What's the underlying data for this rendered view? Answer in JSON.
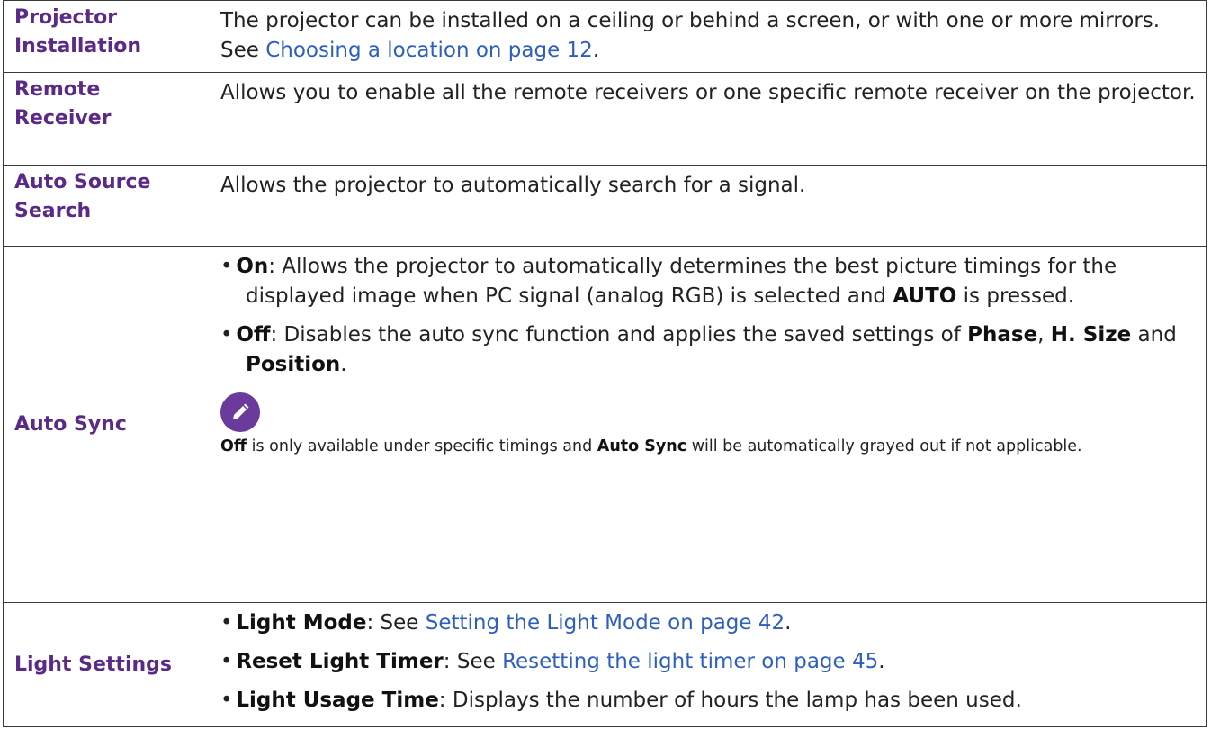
{
  "rows": [
    {
      "term": "Projector Installation",
      "desc_text": "The projector can be installed on a ceiling or behind a screen, or with one or more mirrors. See ",
      "desc_link": "Choosing a location on page 12",
      "desc_after": "."
    },
    {
      "term": "Remote Receiver",
      "desc_text": "Allows you to enable all the remote receivers or one specific remote receiver on the projector."
    },
    {
      "term": "Auto Source Search",
      "desc_text": "Allows the projector to automatically search for a signal."
    },
    {
      "term": "Auto Sync",
      "bullet_on_label": "On",
      "bullet_on_text": ": Allows the projector to automatically determines the best picture timings for the displayed image when PC signal (analog RGB) is selected and ",
      "bullet_on_key": "AUTO",
      "bullet_on_end": " is pressed.",
      "bullet_off_label": "Off",
      "bullet_off_text": ": Disables the auto sync function and applies the saved settings of ",
      "bullet_off_phase": "Phase",
      "bullet_off_comma": ", ",
      "bullet_off_hsize": "H. Size",
      "bullet_off_and": " and ",
      "bullet_off_position": "Position",
      "bullet_off_end": ".",
      "note_icon": "pencil-icon",
      "note_off": "Off",
      "note_text_1": " is only available under specific timings and ",
      "note_autosync": "Auto Sync",
      "note_text_2": " will be automatically grayed out if not applicable."
    },
    {
      "term": "Light Settings",
      "b1_label": "Light Mode",
      "b1_text": ": See ",
      "b1_link": "Setting the Light Mode on page 42",
      "b1_end": ".",
      "b2_label": "Reset Light Timer",
      "b2_text": ": See ",
      "b2_link": "Resetting the light timer on page 45",
      "b2_end": ".",
      "b3_label": "Light Usage Time",
      "b3_text": ": Displays the number of hours the lamp has been used."
    }
  ],
  "colors": {
    "term": "#5b2a86",
    "link": "#2e5fbf",
    "note_icon_bg": "#6a3b9c"
  }
}
